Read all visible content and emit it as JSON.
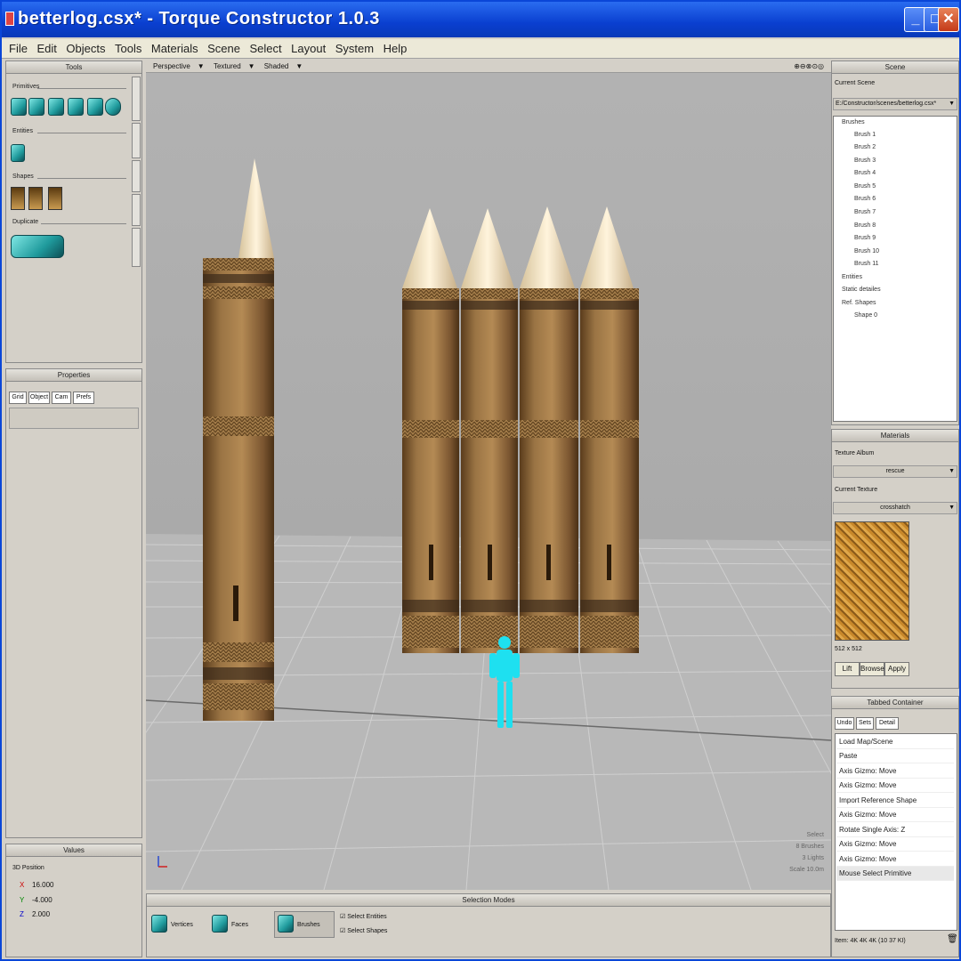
{
  "window": {
    "title": "betterlog.csx* - Torque Constructor 1.0.3"
  },
  "menu": [
    "File",
    "Edit",
    "Objects",
    "Tools",
    "Materials",
    "Scene",
    "Select",
    "Layout",
    "System",
    "Help"
  ],
  "tools": {
    "header": "Tools",
    "groups": {
      "primitives": "Primitives",
      "entities": "Entities",
      "shapes": "Shapes",
      "duplicate": "Duplicate"
    }
  },
  "properties": {
    "header": "Properties",
    "tabs": [
      "Grid",
      "Object",
      "Cam",
      "Prefs"
    ]
  },
  "values": {
    "header": "Values",
    "group": "3D Position",
    "x_label": "X",
    "x": "16.000",
    "y_label": "Y",
    "y": "-4.000",
    "z_label": "Z",
    "z": "2.000"
  },
  "viewport": {
    "view_mode": "Perspective",
    "texture_mode": "Textured",
    "shade_mode": "Shaded",
    "status": [
      "Select",
      "8 Brushes",
      "3 Lights",
      "Scale 10.0m"
    ]
  },
  "selection_modes": {
    "header": "Selection Modes",
    "items": [
      "Vertices",
      "Faces",
      "Brushes"
    ],
    "checks": [
      "Select Entities",
      "Select Shapes"
    ]
  },
  "scene": {
    "header": "Scene",
    "current_scene_label": "Current Scene",
    "current_scene": "E:/Constructor/scenes/betterlog.csx*",
    "tree": [
      "Brushes",
      "Brush 1",
      "Brush 2",
      "Brush 3",
      "Brush 4",
      "Brush 5",
      "Brush 6",
      "Brush 7",
      "Brush 8",
      "Brush 9",
      "Brush 10",
      "Brush 11",
      "Entities",
      "Static detailes",
      "Ref. Shapes",
      "Shape 0"
    ]
  },
  "materials": {
    "header": "Materials",
    "album_label": "Texture Album",
    "album": "rescue",
    "current_label": "Current Texture",
    "current": "crosshatch",
    "size": "512 x 512",
    "buttons": [
      "Lift",
      "Browse",
      "Apply"
    ]
  },
  "tabbed": {
    "header": "Tabbed Container",
    "tabs": [
      "Undo",
      "Sets",
      "Detail"
    ],
    "history": [
      "Load Map/Scene",
      "Paste",
      "Axis Gizmo: Move",
      "Axis Gizmo: Move",
      "Import Reference Shape",
      "Axis Gizmo: Move",
      "Rotate Single Axis: Z",
      "Axis Gizmo: Move",
      "Axis Gizmo: Move",
      "Mouse Select Primitive"
    ],
    "memory": "Item: 4K 4K 4K (10 37 KI)"
  },
  "colors": {
    "title_bar": "#0a46d8",
    "viewport_bg": "#a9a9a9",
    "grid": "#c8c8c8",
    "selection": "#1ee0f0"
  }
}
